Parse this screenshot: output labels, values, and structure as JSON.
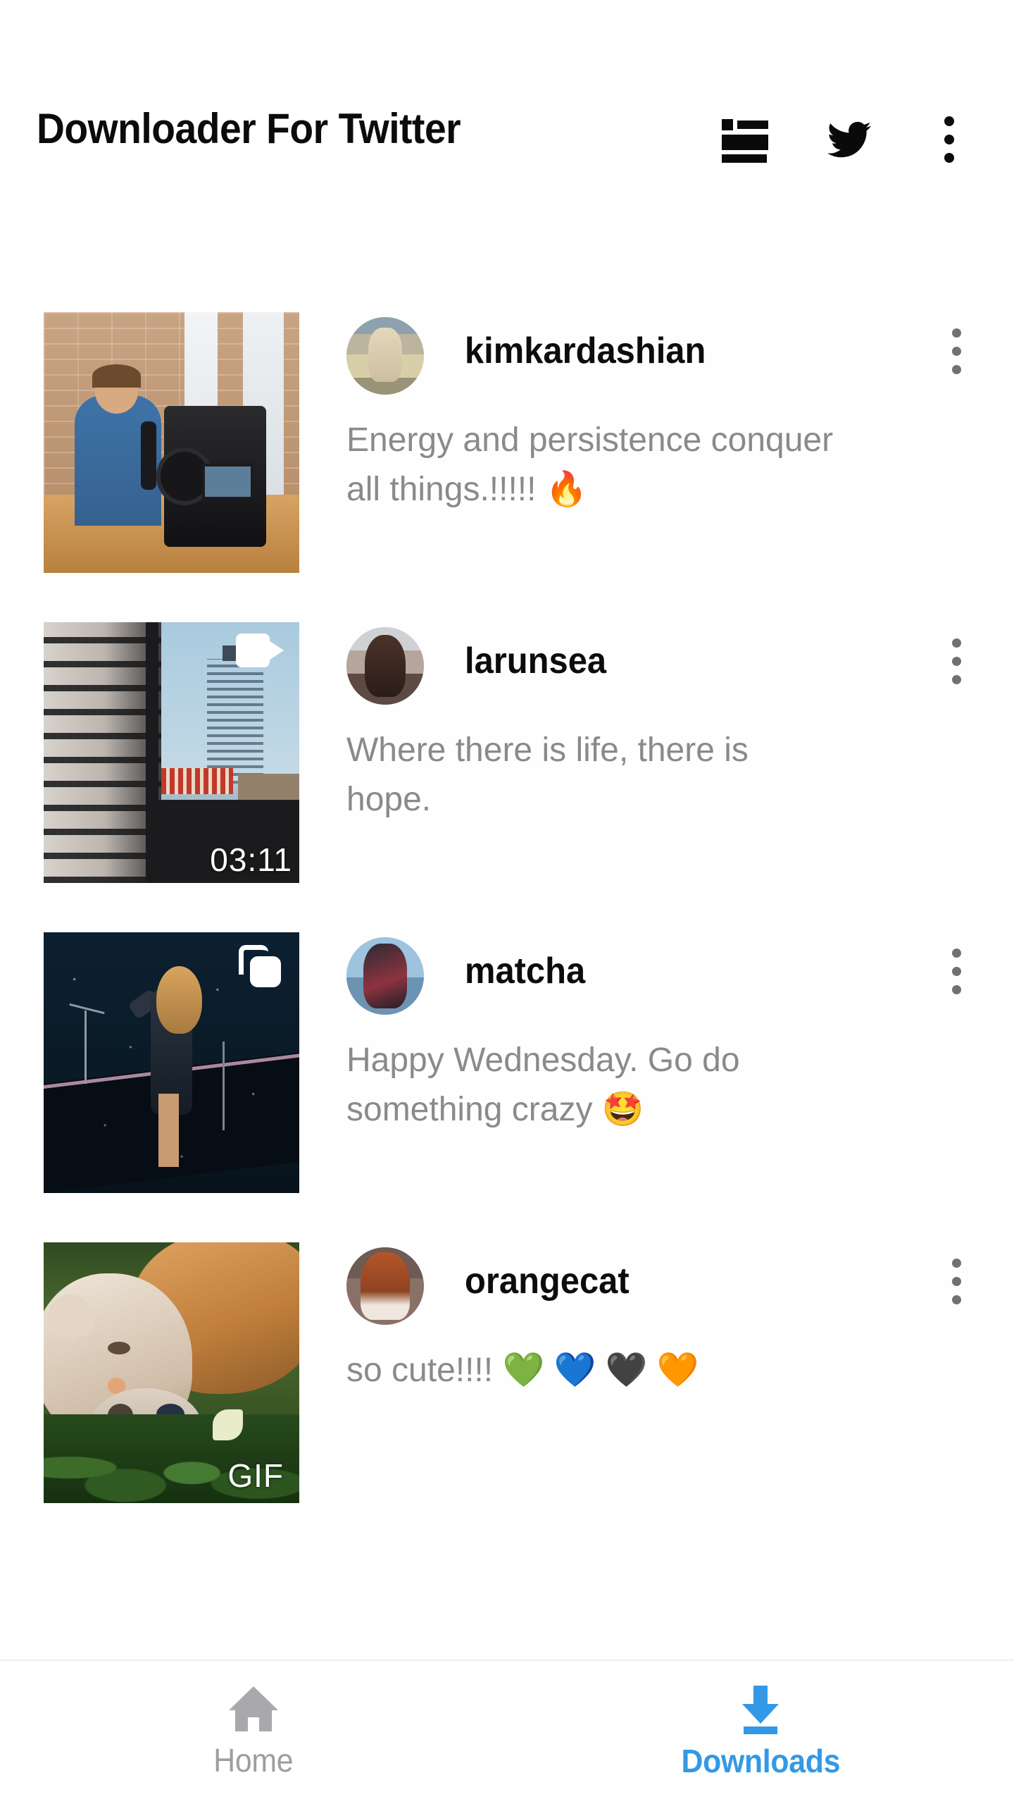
{
  "header": {
    "title": "Downloader For Twitter",
    "icons": [
      {
        "name": "article-list-icon",
        "label": "View as list"
      },
      {
        "name": "twitter-bird-icon",
        "label": "Twitter"
      },
      {
        "name": "overflow-menu-icon",
        "label": "More options"
      }
    ]
  },
  "downloads": {
    "items": [
      {
        "username": "kimkardashian",
        "caption": "Energy and persistence conquer all things.!!!!! 🔥",
        "media_type": "image",
        "badge": "",
        "thumbnail_alt": "Man with headphones at podcast desk being filmed by a video camera",
        "avatar_alt": "Woman in sunglasses and white top outdoors"
      },
      {
        "username": "larunsea",
        "caption": "Where there is life, there is hope.",
        "media_type": "video",
        "badge": "03:11",
        "thumbnail_alt": "City skyline with fire escape and tall tower building",
        "avatar_alt": "Woman with long dark hair and yellow sunglasses"
      },
      {
        "username": "matcha",
        "caption": "Happy Wednesday. Go do something crazy 🤩",
        "media_type": "album",
        "badge": "",
        "thumbnail_alt": "Singer performing on a dark concert stage",
        "avatar_alt": "Woman with arms raised in striped jacket against blue sky"
      },
      {
        "username": "orangecat",
        "caption": "so cute!!!! 💚 💙 🖤 🧡",
        "media_type": "gif",
        "badge": "GIF",
        "thumbnail_alt": "Two cats cuddling in green foliage",
        "avatar_alt": "Woman with long red hair in front of graffiti wall"
      }
    ],
    "row_menu_label": "Item options"
  },
  "bottom_nav": {
    "items": [
      {
        "label": "Home",
        "icon": "home-icon",
        "active": false
      },
      {
        "label": "Downloads",
        "icon": "download-icon",
        "active": true
      }
    ]
  },
  "colors": {
    "accent": "#3399e6",
    "inactive": "#9e9ea2",
    "caption": "#8a8a8a",
    "title": "#0b0b0b",
    "background": "#ffffff"
  }
}
